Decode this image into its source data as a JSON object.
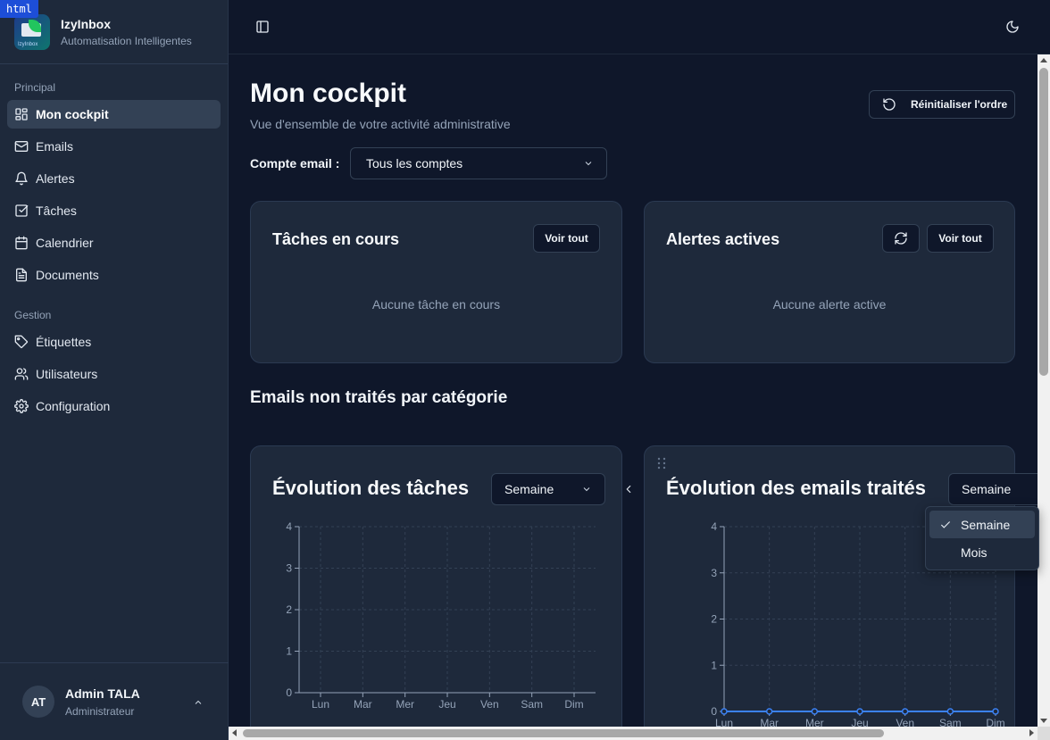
{
  "badge": "html",
  "brand": {
    "name": "IzyInbox",
    "subtitle": "Automatisation Intelligentes",
    "logo_text": "IzyInbox"
  },
  "sidebar": {
    "sections": [
      {
        "title": "Principal",
        "items": [
          {
            "label": "Mon cockpit",
            "icon": "layout-dashboard-icon",
            "active": true
          },
          {
            "label": "Emails",
            "icon": "mail-icon"
          },
          {
            "label": "Alertes",
            "icon": "bell-icon"
          },
          {
            "label": "Tâches",
            "icon": "check-square-icon"
          },
          {
            "label": "Calendrier",
            "icon": "calendar-icon"
          },
          {
            "label": "Documents",
            "icon": "file-text-icon"
          }
        ]
      },
      {
        "title": "Gestion",
        "items": [
          {
            "label": "Étiquettes",
            "icon": "tag-icon"
          },
          {
            "label": "Utilisateurs",
            "icon": "users-icon"
          },
          {
            "label": "Configuration",
            "icon": "settings-icon"
          }
        ]
      }
    ]
  },
  "user": {
    "initials": "AT",
    "name": "Admin TALA",
    "role": "Administrateur"
  },
  "page": {
    "title": "Mon cockpit",
    "subtitle": "Vue d'ensemble de votre activité administrative",
    "reset_label": "Réinitialiser l'ordre",
    "account_label": "Compte email :",
    "account_value": "Tous les comptes"
  },
  "cards": {
    "tasks": {
      "title": "Tâches en cours",
      "button": "Voir tout",
      "empty": "Aucune tâche en cours"
    },
    "alerts": {
      "title": "Alertes actives",
      "button": "Voir tout",
      "empty": "Aucune alerte active"
    }
  },
  "section_emails_title": "Emails non traités par catégorie",
  "charts": {
    "tasks": {
      "title": "Évolution des tâches",
      "period": "Semaine"
    },
    "emails": {
      "title": "Évolution des emails traités",
      "period": "Semaine"
    }
  },
  "period_menu": {
    "options": [
      "Semaine",
      "Mois"
    ],
    "selected": "Semaine"
  },
  "colors": {
    "line": "#3b82f6",
    "legend_dots": [
      "#f59e0b",
      "#3b82f6",
      "#10b981"
    ]
  },
  "chart_data": [
    {
      "type": "line",
      "title": "Évolution des tâches",
      "categories": [
        "Lun",
        "Mar",
        "Mer",
        "Jeu",
        "Ven",
        "Sam",
        "Dim"
      ],
      "series": [],
      "ylim": [
        0,
        4
      ],
      "yticks": [
        0,
        1,
        2,
        3,
        4
      ],
      "grid": true
    },
    {
      "type": "line",
      "title": "Évolution des emails traités",
      "categories": [
        "Lun",
        "Mar",
        "Mer",
        "Jeu",
        "Ven",
        "Sam",
        "Dim"
      ],
      "series": [
        {
          "values": [
            0,
            0,
            0,
            0,
            0,
            0,
            0
          ]
        }
      ],
      "ylim": [
        0,
        4
      ],
      "yticks": [
        0,
        1,
        2,
        3,
        4
      ],
      "grid": true
    }
  ]
}
